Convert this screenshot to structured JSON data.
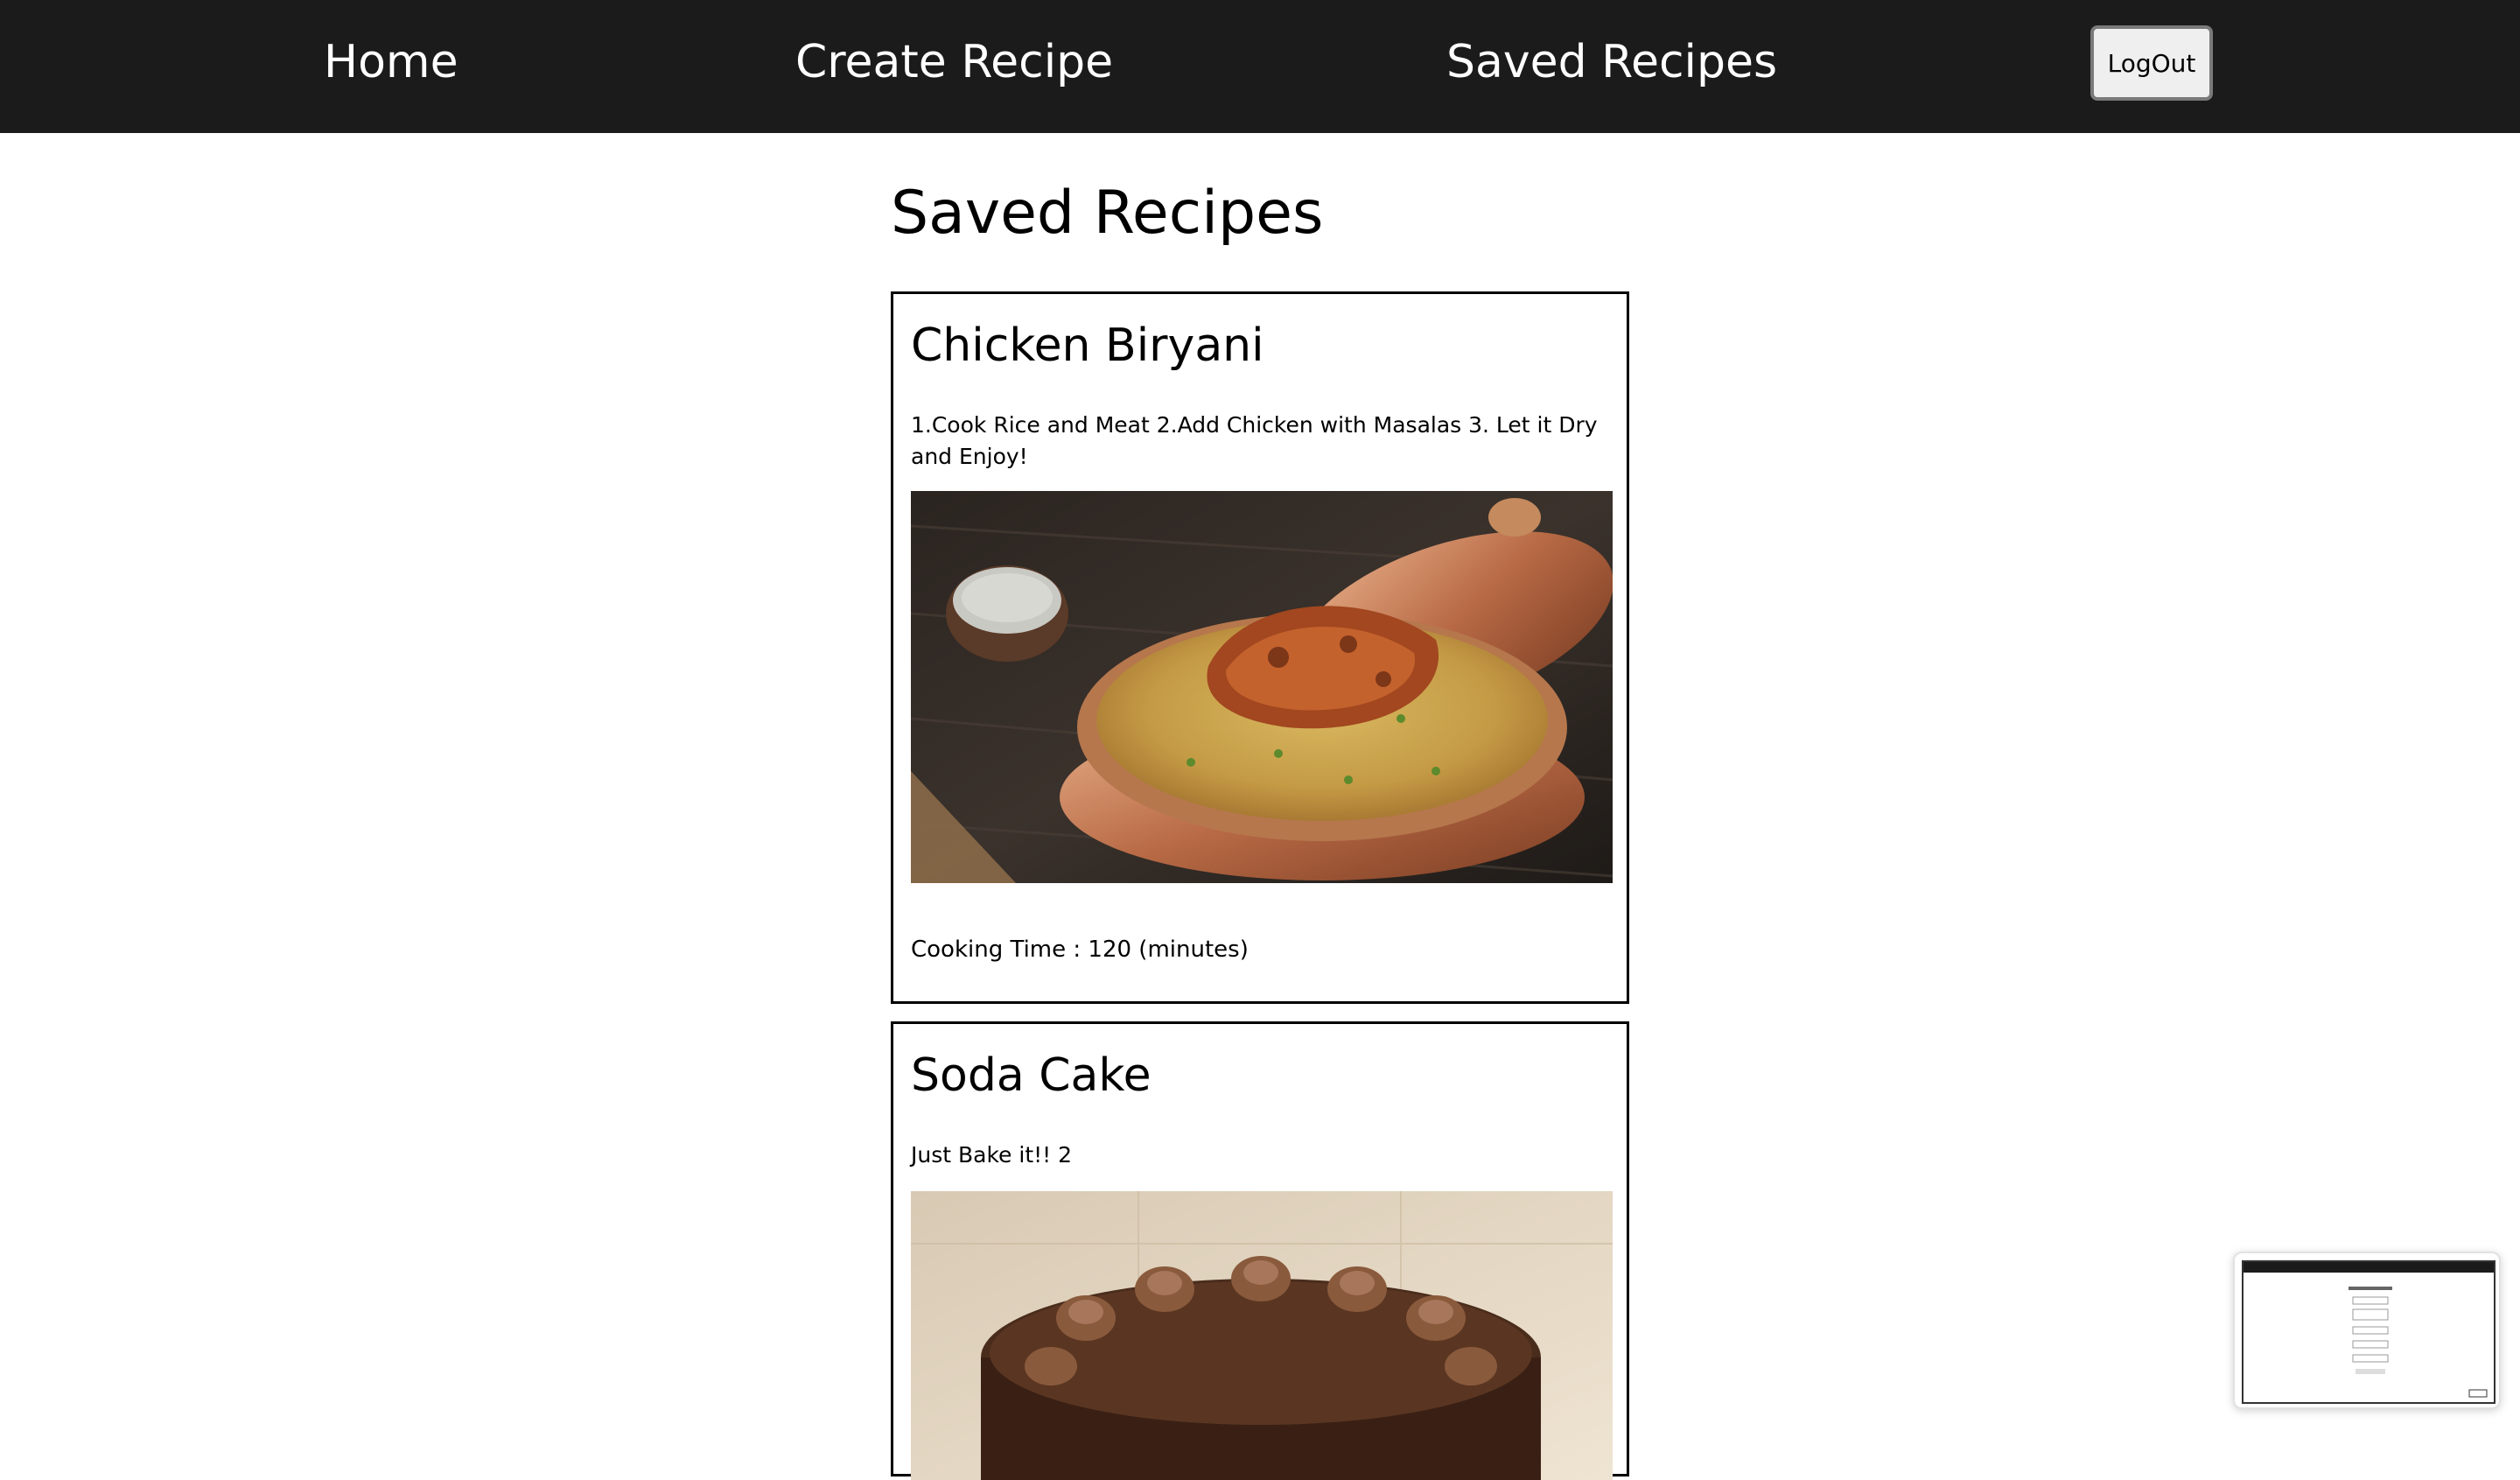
{
  "nav": {
    "home": "Home",
    "create": "Create Recipe",
    "saved": "Saved Recipes",
    "logout": "LogOut"
  },
  "page": {
    "title": "Saved Recipes"
  },
  "recipes": [
    {
      "name": "Chicken Biryani",
      "instructions": "1.Cook Rice and Meat 2.Add Chicken with Masalas 3. Let it Dry and Enjoy!",
      "cooking_time": "Cooking Time : 120 (minutes)"
    },
    {
      "name": "Soda Cake",
      "instructions": "Just Bake it!! 2"
    }
  ],
  "colors": {
    "navbar_bg": "#1b1b1b",
    "nav_text": "#ffffff",
    "card_border": "#000000",
    "button_bg": "#efefef"
  }
}
